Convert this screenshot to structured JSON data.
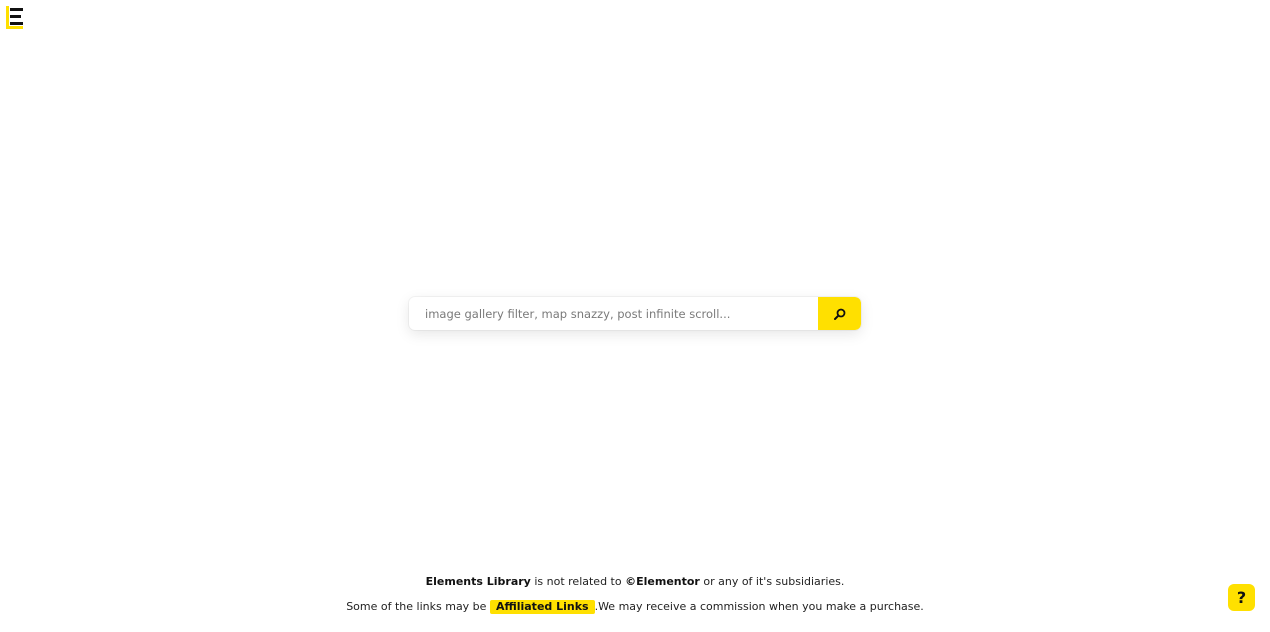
{
  "colors": {
    "accent": "#ffe000",
    "text": "#111111",
    "background": "#ffffff"
  },
  "logo": {
    "icon": "elements-library-logo-icon"
  },
  "search": {
    "placeholder": "image gallery filter, map snazzy, post infinite scroll...",
    "value": "",
    "button_icon": "search-icon"
  },
  "footer": {
    "line1": {
      "brand": "Elements Library",
      "text_a": " is not related to ",
      "elementor": "©Elementor",
      "text_b": " or any of it's subsidiaries."
    },
    "line2": {
      "text_a": "Some of the links may be ",
      "affiliated_label": "Affiliated Links",
      "text_b": ".We may receive a commission when you make a purchase."
    }
  },
  "help": {
    "label": "?"
  }
}
